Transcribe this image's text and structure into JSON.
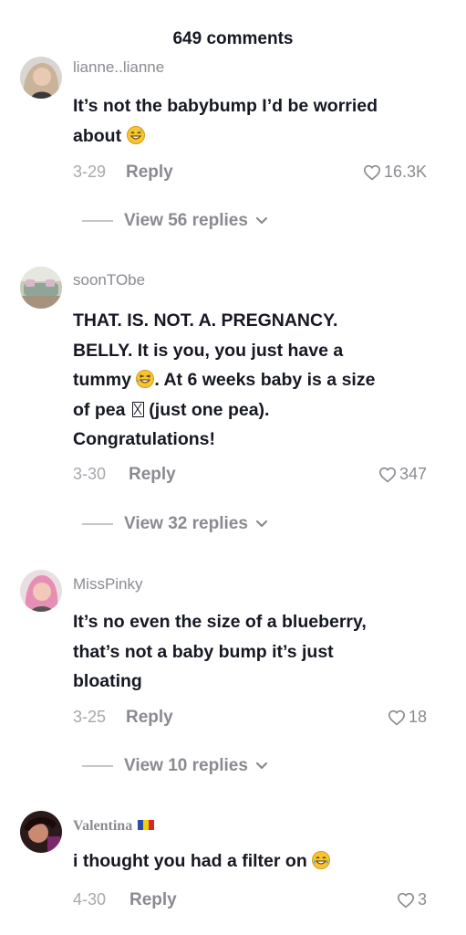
{
  "header": {
    "title": "649 comments"
  },
  "comments": [
    {
      "username": "lianne..lianne",
      "text_lines": [
        "It’s not the babybump I’d be worried",
        "about"
      ],
      "date": "3-29",
      "reply_label": "Reply",
      "likes": "16.3K",
      "view_replies": "View 56 replies"
    },
    {
      "username": "soonTObe",
      "text_lines": [
        "THAT. IS. NOT. A. PREGNANCY.",
        "BELLY. It is you, you just have a",
        "tummy",
        ". At 6 weeks baby is a size",
        "of pea",
        " (just one pea).",
        "Congratulations!"
      ],
      "date": "3-30",
      "reply_label": "Reply",
      "likes": "347",
      "view_replies": "View 32 replies"
    },
    {
      "username": "MissPinky",
      "text_lines": [
        "It’s no even the size of a blueberry,",
        "that’s not a baby bump it’s just",
        "bloating"
      ],
      "date": "3-25",
      "reply_label": "Reply",
      "likes": "18",
      "view_replies": "View 10 replies"
    },
    {
      "username": "Valentina",
      "text_lines": [
        "i thought you had a filter on"
      ],
      "date": "4-30",
      "reply_label": "Reply",
      "likes": "3",
      "flag_colors": [
        "#2b4fa8",
        "#f5d000",
        "#d62828"
      ]
    }
  ],
  "colors": {
    "text_primary": "#161823",
    "text_secondary": "#8a8b91",
    "emoji_yellow": "#f7c531"
  },
  "icons": {
    "like": "heart-outline-icon",
    "expand": "chevron-down-icon"
  }
}
